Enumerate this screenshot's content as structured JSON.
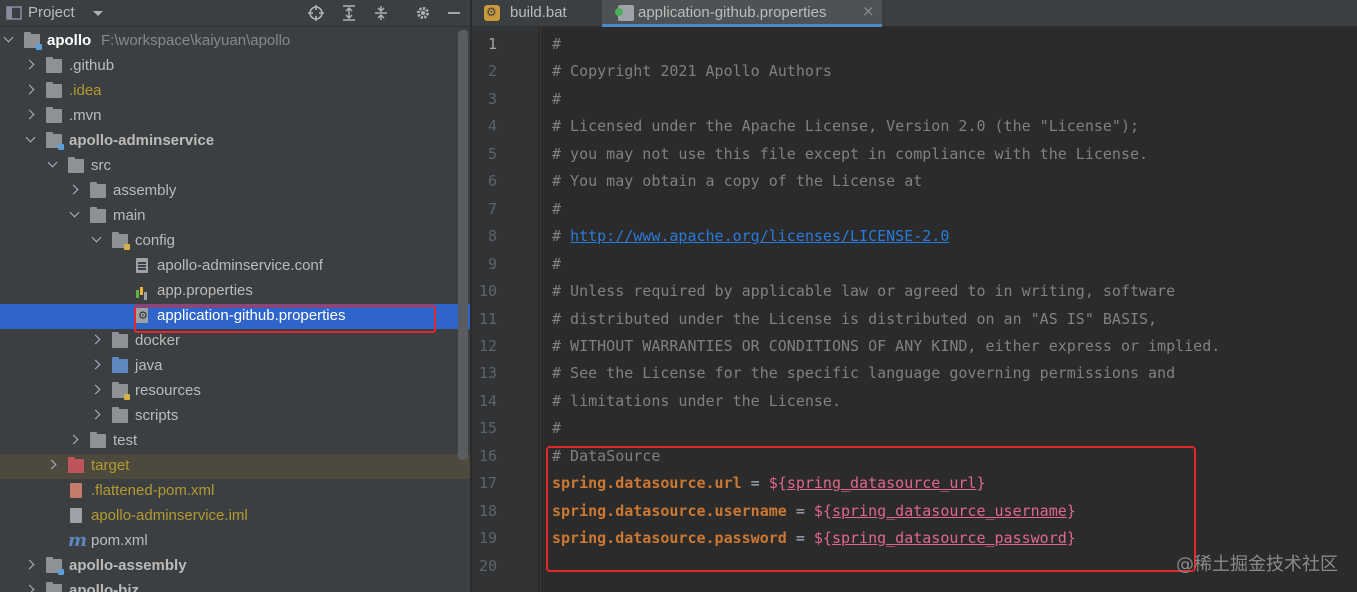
{
  "project_panel": {
    "title": "Project",
    "icons": [
      "locate-icon",
      "expand-all-icon",
      "collapse-all-icon",
      "settings-icon",
      "hide-icon"
    ]
  },
  "tree": [
    {
      "label": "apollo",
      "path": "F:\\workspace\\kaiyuan\\apollo",
      "style": "bold white",
      "arrow": "down",
      "icon": "module-folder",
      "depth": 0
    },
    {
      "label": ".github",
      "style": "",
      "arrow": "right",
      "icon": "folder",
      "depth": 1
    },
    {
      "label": ".idea",
      "style": "yellow",
      "arrow": "right",
      "icon": "folder",
      "depth": 1
    },
    {
      "label": ".mvn",
      "style": "",
      "arrow": "right",
      "icon": "folder",
      "depth": 1
    },
    {
      "label": "apollo-adminservice",
      "style": "bold",
      "arrow": "down",
      "icon": "module-folder",
      "depth": 1
    },
    {
      "label": "src",
      "style": "",
      "arrow": "down",
      "icon": "folder",
      "depth": 2
    },
    {
      "label": "assembly",
      "style": "",
      "arrow": "right",
      "icon": "folder",
      "depth": 3
    },
    {
      "label": "main",
      "style": "",
      "arrow": "down",
      "icon": "folder",
      "depth": 3
    },
    {
      "label": "config",
      "style": "",
      "arrow": "down",
      "icon": "resource-folder",
      "depth": 4
    },
    {
      "label": "apollo-adminservice.conf",
      "style": "",
      "arrow": "",
      "icon": "config-file",
      "depth": 5
    },
    {
      "label": "app.properties",
      "style": "",
      "arrow": "",
      "icon": "properties-file",
      "depth": 5
    },
    {
      "label": "application-github.properties",
      "style": "white",
      "arrow": "",
      "icon": "gear-file",
      "depth": 5,
      "selected": true
    },
    {
      "label": "docker",
      "style": "",
      "arrow": "right",
      "icon": "folder",
      "depth": 4
    },
    {
      "label": "java",
      "style": "",
      "arrow": "right",
      "icon": "source-folder",
      "depth": 4
    },
    {
      "label": "resources",
      "style": "",
      "arrow": "right",
      "icon": "resource-folder",
      "depth": 4
    },
    {
      "label": "scripts",
      "style": "",
      "arrow": "right",
      "icon": "folder",
      "depth": 4
    },
    {
      "label": "test",
      "style": "",
      "arrow": "right",
      "icon": "folder",
      "depth": 3
    },
    {
      "label": "target",
      "style": "yellow",
      "arrow": "right",
      "icon": "excluded-folder",
      "depth": 2,
      "excluded": true
    },
    {
      "label": ".flattened-pom.xml",
      "style": "yellow",
      "arrow": "",
      "icon": "xml-file",
      "depth": 2
    },
    {
      "label": "apollo-adminservice.iml",
      "style": "yellow",
      "arrow": "",
      "icon": "module-file",
      "depth": 2
    },
    {
      "label": "pom.xml",
      "style": "",
      "arrow": "",
      "icon": "maven-file",
      "depth": 2
    },
    {
      "label": "apollo-assembly",
      "style": "bold",
      "arrow": "right",
      "icon": "module-folder",
      "depth": 1
    },
    {
      "label": "apollo-biz",
      "style": "bold",
      "arrow": "right",
      "icon": "module-folder",
      "depth": 1
    }
  ],
  "tabs": [
    {
      "label": "build.bat",
      "icon": "bat-file-icon",
      "active": false
    },
    {
      "label": "application-github.properties",
      "icon": "properties-file-icon",
      "active": true,
      "close": "×"
    }
  ],
  "editor": {
    "current_line": 1,
    "lines": [
      [
        {
          "t": "#",
          "c": "cm"
        }
      ],
      [
        {
          "t": "# Copyright 2021 Apollo Authors",
          "c": "cm"
        }
      ],
      [
        {
          "t": "#",
          "c": "cm"
        }
      ],
      [
        {
          "t": "# Licensed under the Apache License, Version 2.0 (the \"License\");",
          "c": "cm"
        }
      ],
      [
        {
          "t": "# you may not use this file except in compliance with the License.",
          "c": "cm"
        }
      ],
      [
        {
          "t": "# You may obtain a copy of the License at",
          "c": "cm"
        }
      ],
      [
        {
          "t": "#",
          "c": "cm"
        }
      ],
      [
        {
          "t": "# ",
          "c": "cm"
        },
        {
          "t": "http://www.apache.org/licenses/LICENSE-2.0",
          "c": "url"
        }
      ],
      [
        {
          "t": "#",
          "c": "cm"
        }
      ],
      [
        {
          "t": "# Unless required by applicable law or agreed to in writing, software",
          "c": "cm"
        }
      ],
      [
        {
          "t": "# distributed under the License is distributed on an \"AS IS\" BASIS,",
          "c": "cm"
        }
      ],
      [
        {
          "t": "# WITHOUT WARRANTIES OR CONDITIONS OF ANY KIND, either express or implied.",
          "c": "cm"
        }
      ],
      [
        {
          "t": "# See the License for the specific language governing permissions and",
          "c": "cm"
        }
      ],
      [
        {
          "t": "# limitations under the License.",
          "c": "cm"
        }
      ],
      [
        {
          "t": "#",
          "c": "cm"
        }
      ],
      [
        {
          "t": "# DataSource",
          "c": "cm"
        }
      ],
      [
        {
          "t": "spring.datasource.url",
          "c": "key"
        },
        {
          "t": " = ",
          "c": "eq"
        },
        {
          "t": "${",
          "c": "brace"
        },
        {
          "t": "spring_datasource_url",
          "c": "var"
        },
        {
          "t": "}",
          "c": "brace"
        }
      ],
      [
        {
          "t": "spring.datasource.username",
          "c": "key"
        },
        {
          "t": " = ",
          "c": "eq"
        },
        {
          "t": "${",
          "c": "brace"
        },
        {
          "t": "spring_datasource_username",
          "c": "var"
        },
        {
          "t": "}",
          "c": "brace"
        }
      ],
      [
        {
          "t": "spring.datasource.password",
          "c": "key"
        },
        {
          "t": " = ",
          "c": "eq"
        },
        {
          "t": "${",
          "c": "brace"
        },
        {
          "t": "spring_datasource_password",
          "c": "var"
        },
        {
          "t": "}",
          "c": "brace"
        }
      ],
      []
    ]
  },
  "watermark": "@稀土掘金技术社区",
  "colors": {
    "highlight_box": "#e0292b",
    "selection": "#2f65ca",
    "key": "#cc7832",
    "comment": "#808080",
    "variable": "#e0678b"
  }
}
